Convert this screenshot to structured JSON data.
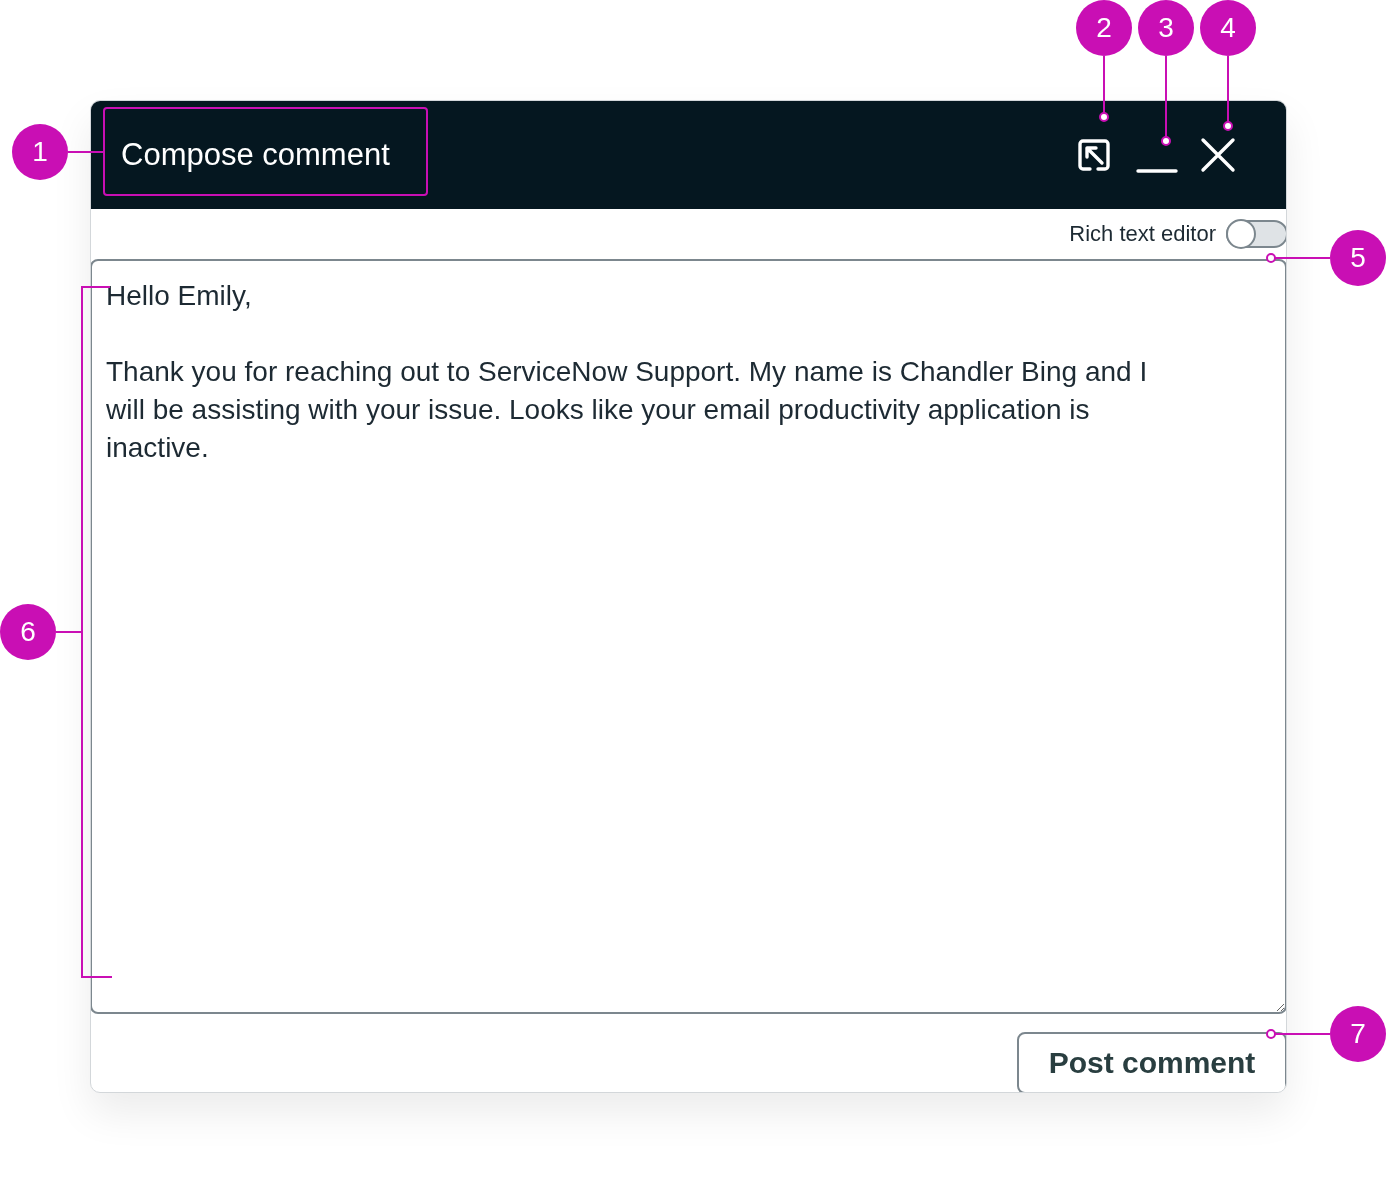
{
  "window": {
    "title": "Compose comment"
  },
  "header_controls": [
    {
      "kind": "popout"
    },
    {
      "kind": "minimize"
    },
    {
      "kind": "close"
    }
  ],
  "toggle": {
    "label": "Rich text editor",
    "on": false
  },
  "textarea": {
    "value": "Hello Emily,\n\nThank you for reaching out to ServiceNow Support. My name is Chandler Bing and I will be assisting with your issue. Looks like your email productivity application is inactive."
  },
  "button": {
    "label": "Post comment"
  },
  "callouts": [
    "1",
    "2",
    "3",
    "4",
    "5",
    "6",
    "7"
  ]
}
